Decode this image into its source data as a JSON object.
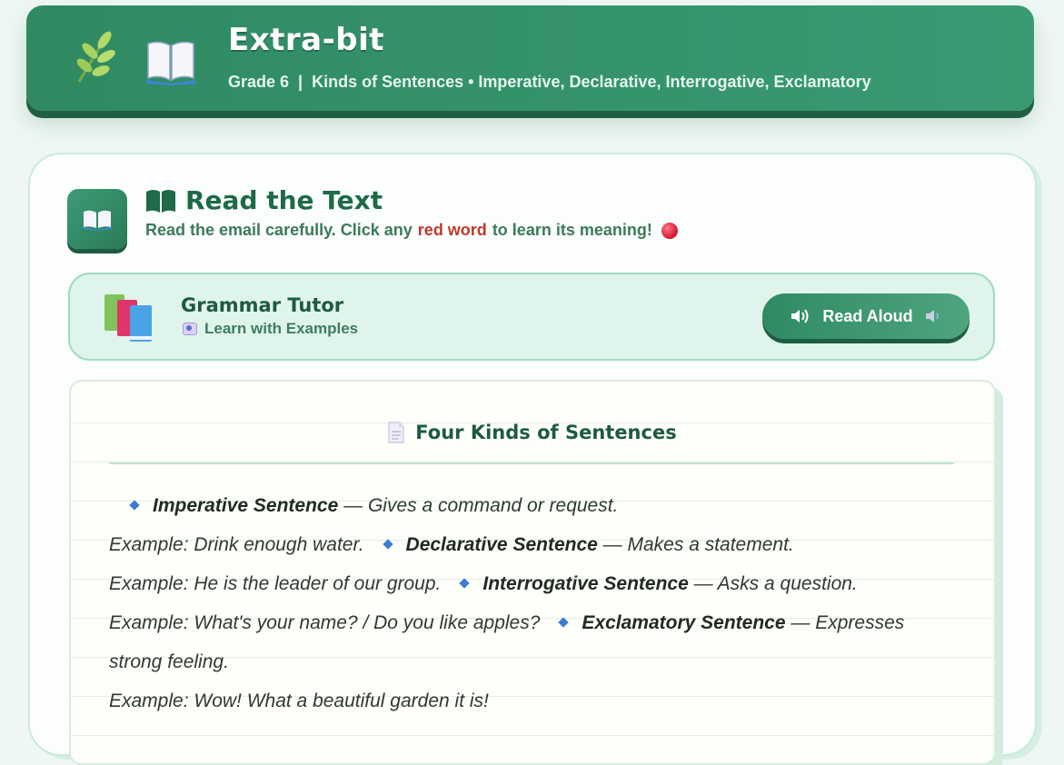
{
  "header": {
    "title": "Extra-bit",
    "subtitle": "Grade 6  |  Kinds of Sentences • Imperative, Declarative, Interrogative, Exclamatory",
    "icons": [
      "leaf-icon",
      "open-book-icon"
    ]
  },
  "section": {
    "title": "Read the Text",
    "instruction_pre": "Read the email carefully. Click any",
    "instruction_red": "red word",
    "instruction_post": "to learn its meaning!"
  },
  "tutor": {
    "name": "Grammar Tutor",
    "learn": "Learn with Examples",
    "read_aloud": "Read Aloud"
  },
  "notebook": {
    "title": "Four Kinds of Sentences",
    "items": [
      {
        "term": "Imperative Sentence",
        "desc": "— Gives a command or request.",
        "example": "Example: Drink enough water."
      },
      {
        "term": "Declarative Sentence",
        "desc": "— Makes a statement.",
        "example": "Example: He is the leader of our group."
      },
      {
        "term": "Interrogative Sentence",
        "desc": "— Asks a question.",
        "example": "Example: What's your name? / Do you like apples?"
      },
      {
        "term": "Exclamatory Sentence",
        "desc": "— Expresses strong feeling.",
        "example": "Example: Wow! What a beautiful garden it is!"
      }
    ]
  },
  "colors": {
    "brand_green": "#2f8a62",
    "dark_green": "#1d6a46",
    "red_word": "#c0392b",
    "diamond_blue": "#3b7bd1"
  }
}
